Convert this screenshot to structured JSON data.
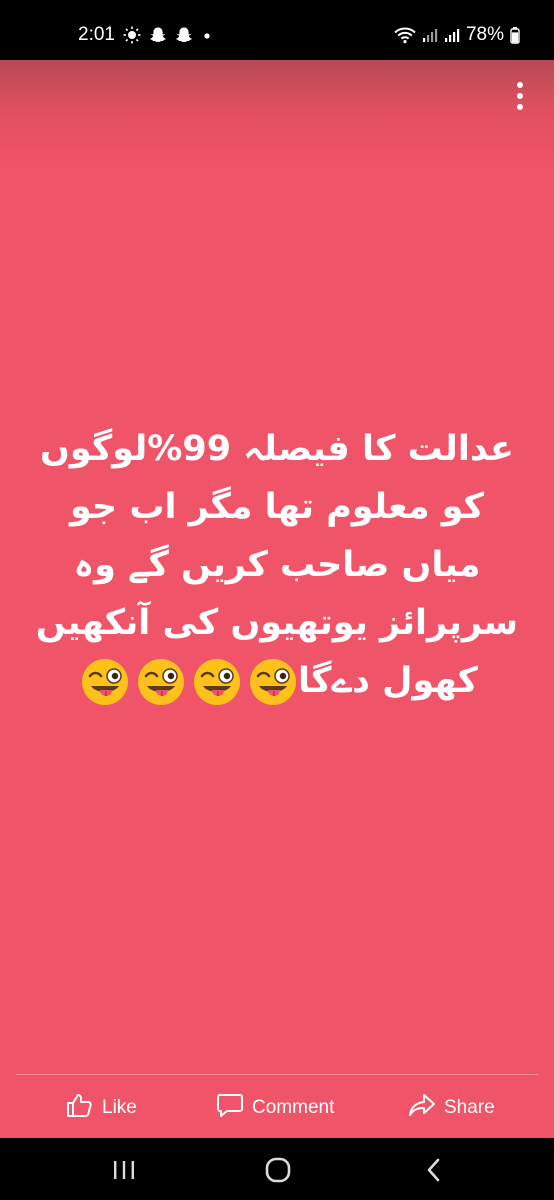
{
  "status_bar": {
    "time": "2:01",
    "battery": "78%",
    "notification_icons": [
      "weather-icon",
      "snapchat-icon",
      "snapchat-icon",
      "dot-icon"
    ]
  },
  "post": {
    "lines": [
      "عدالت کا فیصلہ 99%لوگوں",
      "کو معلوم تھا مگر اب جو",
      "میاں صاحب کریں گے وہ",
      "سرپرائز یوتھیوں کی آنکھیں",
      "کھول دےگا"
    ],
    "emoji": [
      "😜",
      "😜",
      "😜",
      "😜"
    ],
    "background_color": "#f05468"
  },
  "actions": {
    "like": "Like",
    "comment": "Comment",
    "share": "Share"
  }
}
